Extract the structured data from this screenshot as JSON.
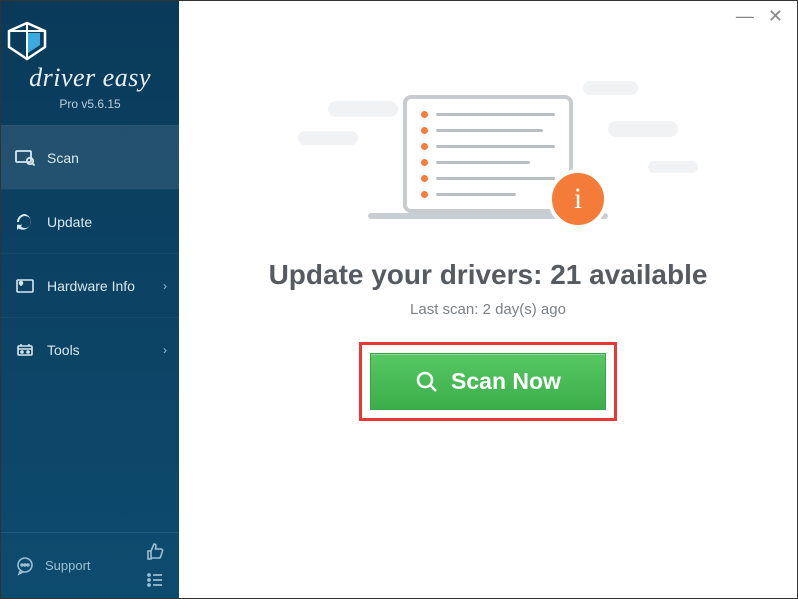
{
  "app": {
    "brand": "driver easy",
    "version": "Pro v5.6.15"
  },
  "sidebar": {
    "items": [
      {
        "label": "Scan",
        "has_chevron": false
      },
      {
        "label": "Update",
        "has_chevron": false
      },
      {
        "label": "Hardware Info",
        "has_chevron": true
      },
      {
        "label": "Tools",
        "has_chevron": true
      }
    ],
    "support_label": "Support"
  },
  "main": {
    "headline": "Update your drivers: 21 available",
    "last_scan": "Last scan: 2 day(s) ago",
    "scan_button": "Scan Now"
  },
  "colors": {
    "sidebar_bg": "#0d4b6e",
    "accent_orange": "#F47B38",
    "scan_green": "#3bae4a",
    "annotation_red": "#e53935"
  }
}
